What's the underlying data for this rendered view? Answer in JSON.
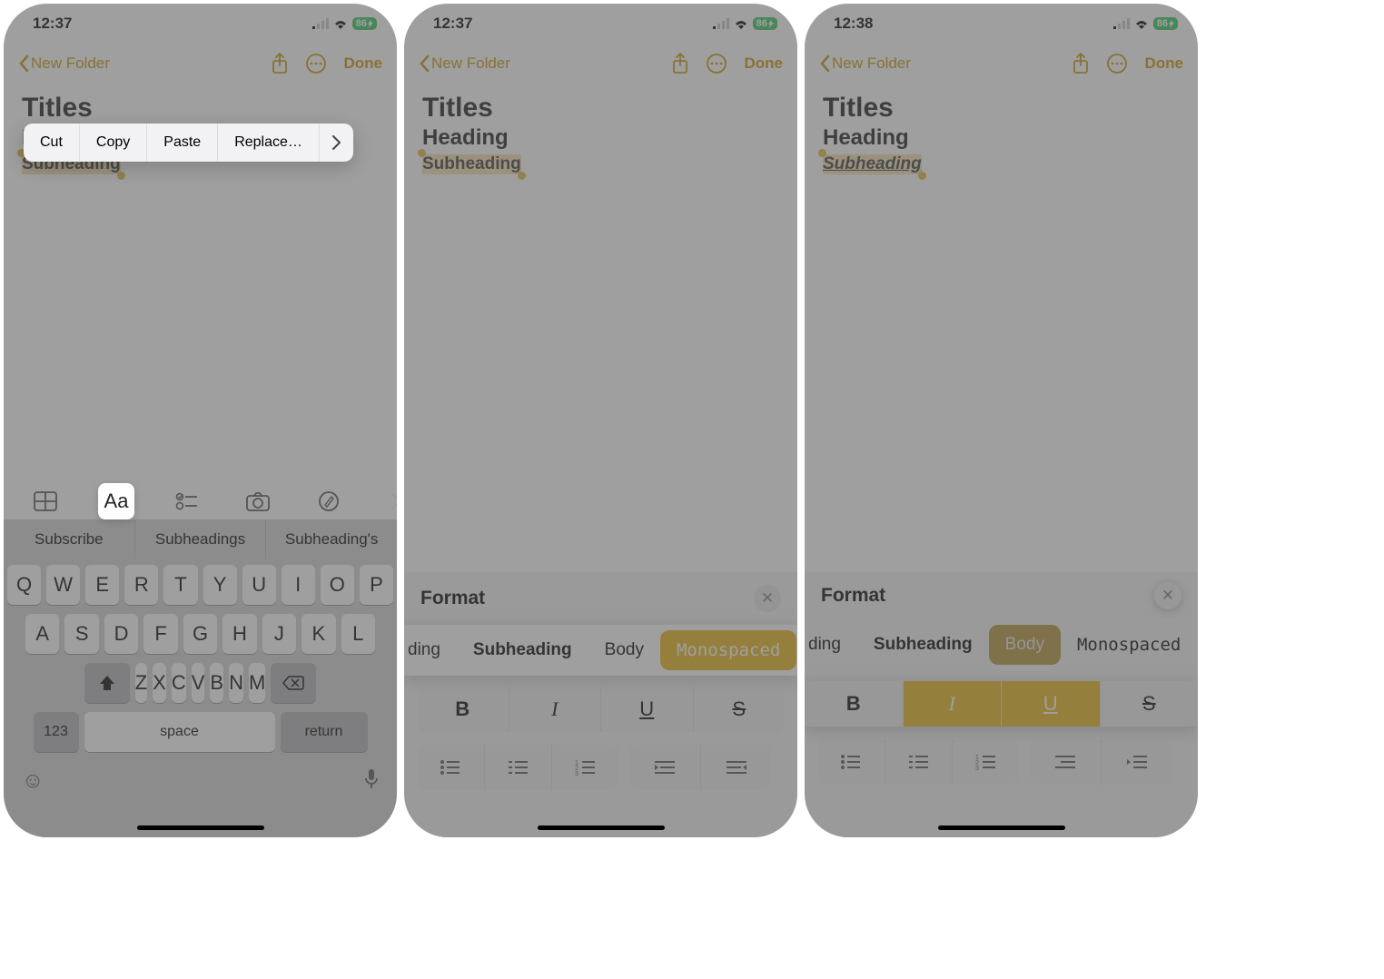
{
  "status": {
    "time_a": "12:37",
    "time_b": "12:37",
    "time_c": "12:38",
    "battery": "86"
  },
  "nav": {
    "back": "New Folder",
    "done": "Done"
  },
  "note": {
    "title": "Titles",
    "heading": "Heading",
    "subheading": "Subheading"
  },
  "context_menu": [
    "Cut",
    "Copy",
    "Paste",
    "Replace…"
  ],
  "suggestions": [
    "Subscribe",
    "Subheadings",
    "Subheading's"
  ],
  "keyboard": {
    "row1": [
      "Q",
      "W",
      "E",
      "R",
      "T",
      "Y",
      "U",
      "I",
      "O",
      "P"
    ],
    "row2": [
      "A",
      "S",
      "D",
      "F",
      "G",
      "H",
      "J",
      "K",
      "L"
    ],
    "row3": [
      "Z",
      "X",
      "C",
      "V",
      "B",
      "N",
      "M"
    ],
    "numbers": "123",
    "space": "space",
    "ret": "return"
  },
  "format": {
    "title": "Format",
    "styles_frag": "ding",
    "styles": [
      "Subheading",
      "Body",
      "Monospaced"
    ],
    "biu": [
      "B",
      "I",
      "U",
      "S"
    ]
  }
}
